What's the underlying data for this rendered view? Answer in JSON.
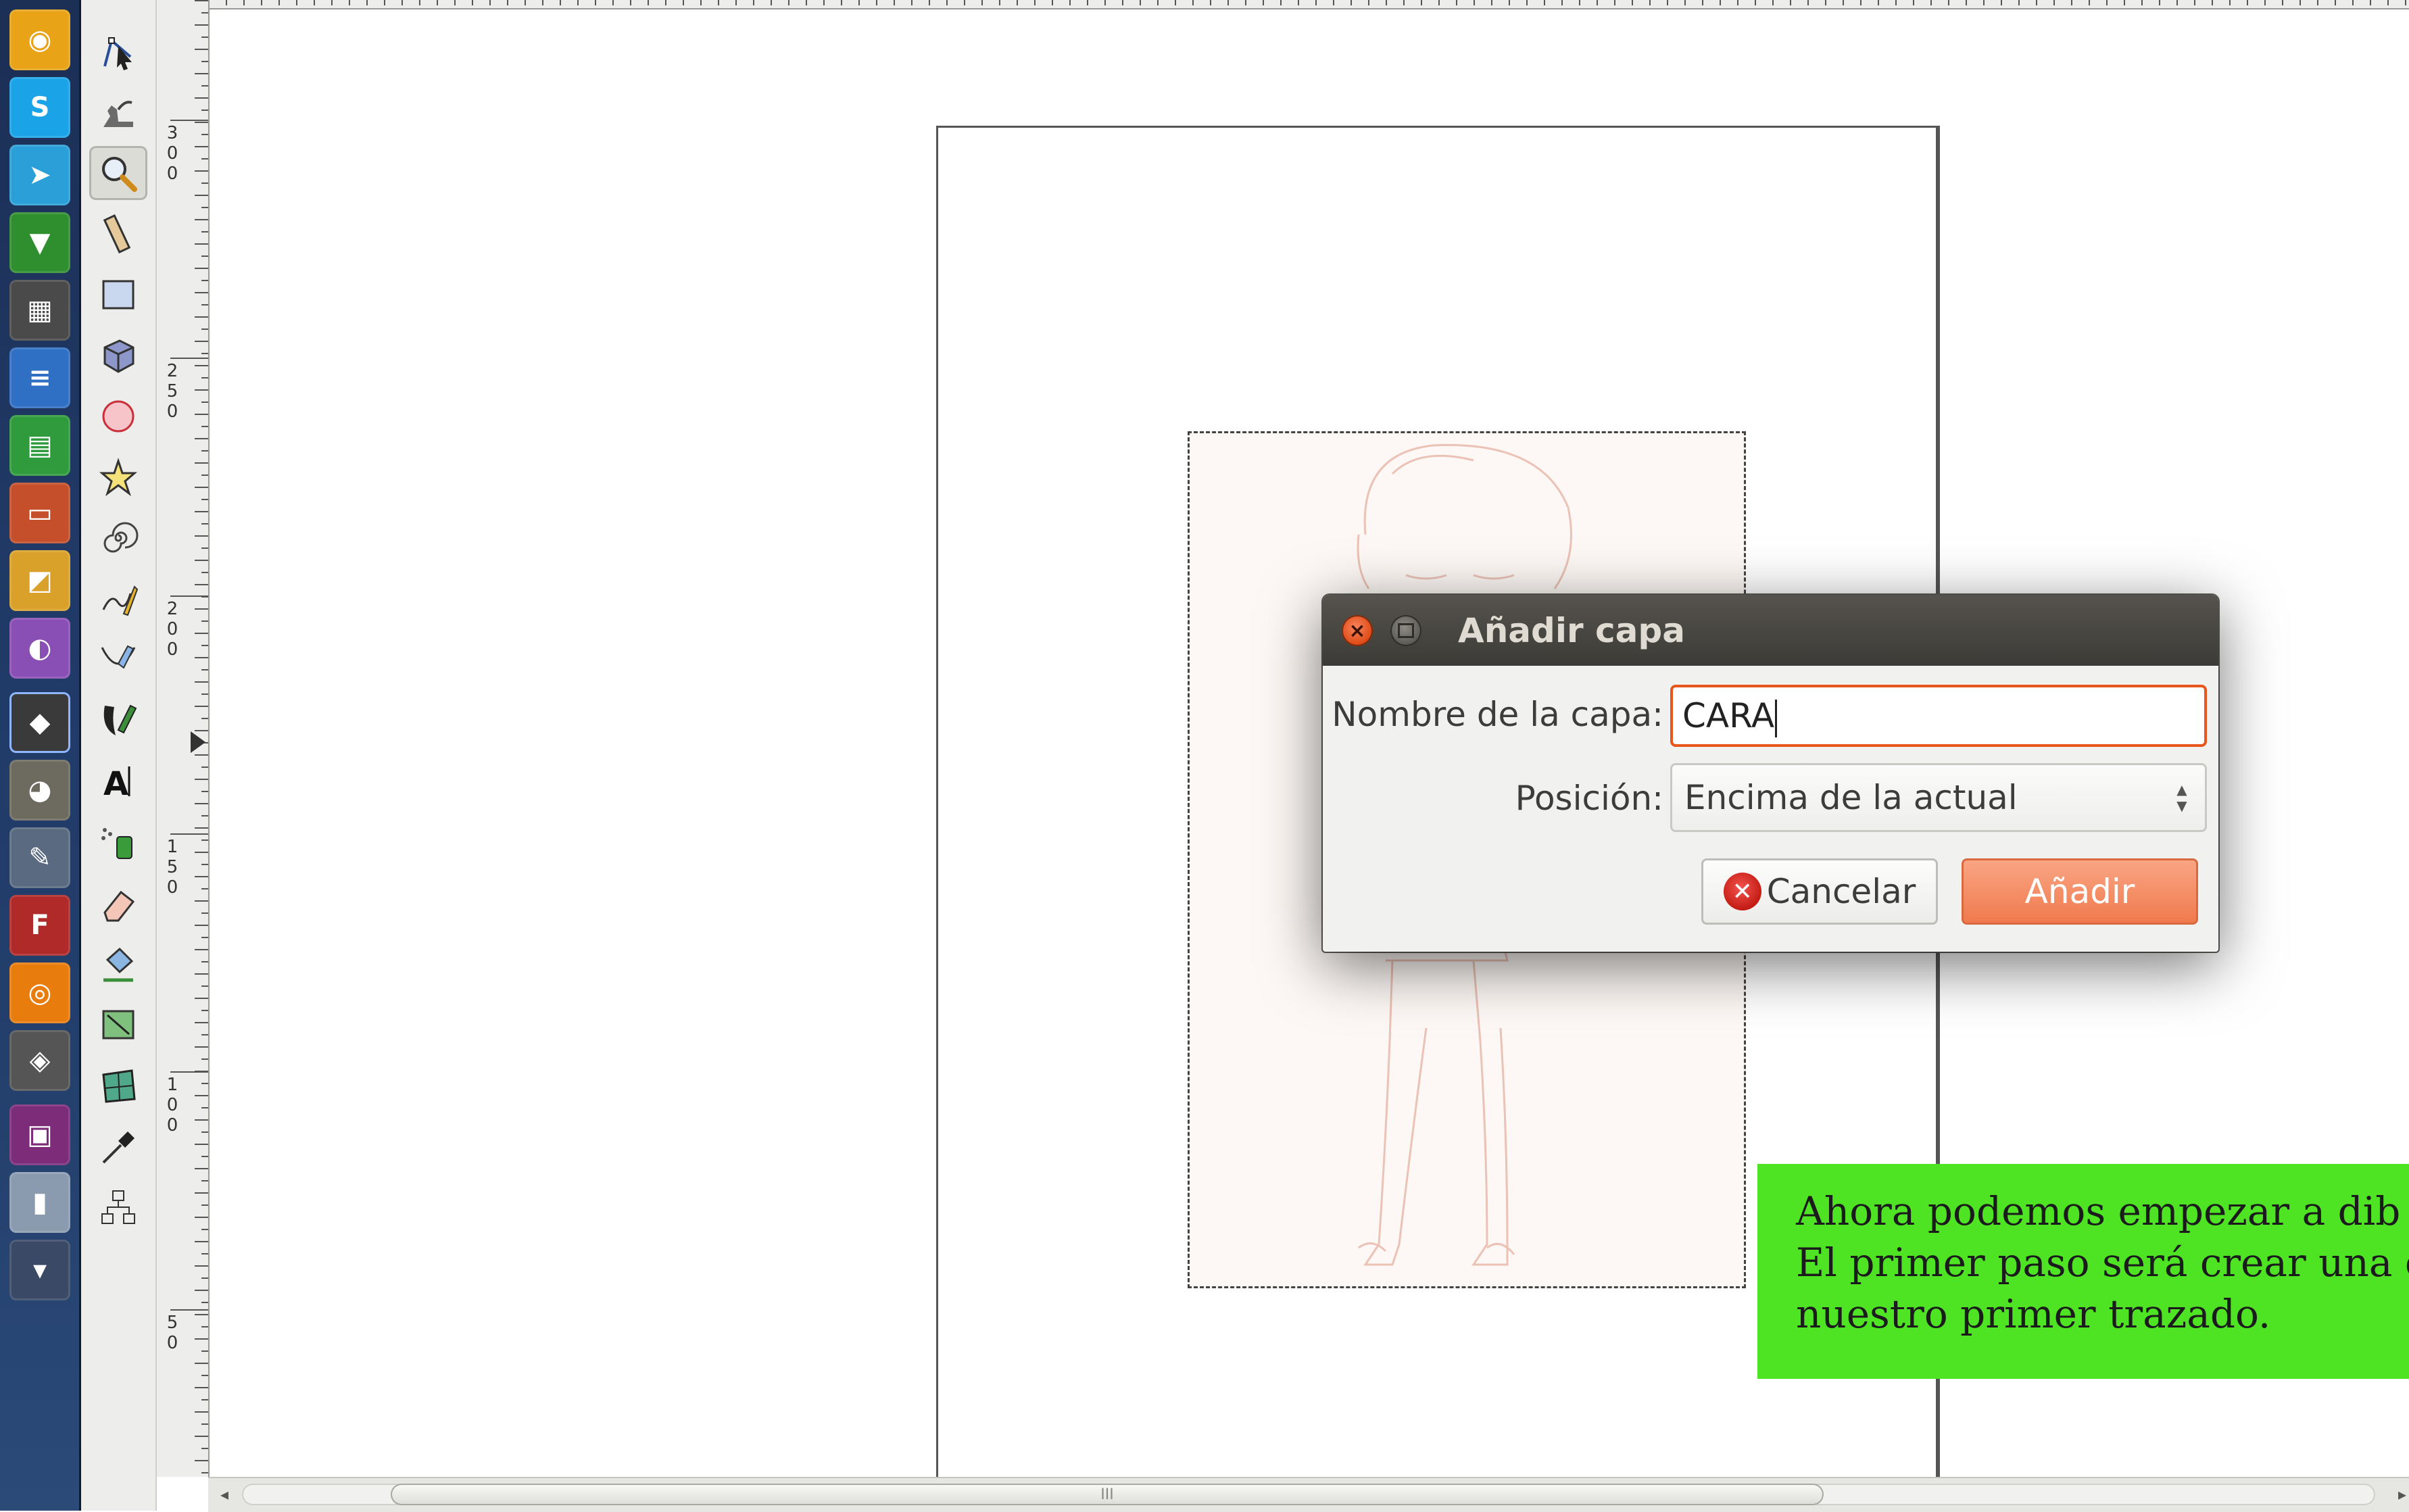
{
  "launcher": {
    "apps": [
      {
        "name": "chrome",
        "color": "#e8a317",
        "glyph": "◉"
      },
      {
        "name": "skype",
        "color": "#1aa3e6",
        "glyph": "S"
      },
      {
        "name": "telegram",
        "color": "#2b9fd8",
        "glyph": "➤"
      },
      {
        "name": "green-app",
        "color": "#2f8f2f",
        "glyph": "▼"
      },
      {
        "name": "calculator",
        "color": "#4a4a4a",
        "glyph": "▦"
      },
      {
        "name": "writer",
        "color": "#2f6fc4",
        "glyph": "≡"
      },
      {
        "name": "calc",
        "color": "#2f9b3c",
        "glyph": "▤"
      },
      {
        "name": "impress",
        "color": "#c44f2a",
        "glyph": "▭"
      },
      {
        "name": "draw",
        "color": "#d9a12a",
        "glyph": "◩"
      },
      {
        "name": "color-app",
        "color": "#8a4fb5",
        "glyph": "◐"
      },
      {
        "name": "inkscape",
        "color": "#3a3a3a",
        "glyph": "◆"
      },
      {
        "name": "gimp",
        "color": "#6d6a5f",
        "glyph": "◕"
      },
      {
        "name": "editor",
        "color": "#5a6a80",
        "glyph": "✎"
      },
      {
        "name": "fontforge",
        "color": "#b02a2a",
        "glyph": "F"
      },
      {
        "name": "blender",
        "color": "#e87d0d",
        "glyph": "◎"
      },
      {
        "name": "box-app",
        "color": "#555555",
        "glyph": "◈"
      },
      {
        "name": "window-app",
        "color": "#7d2c7a",
        "glyph": "▣"
      },
      {
        "name": "storage",
        "color": "#8a9bb0",
        "glyph": "▮"
      },
      {
        "name": "trash",
        "color": "#3a4a66",
        "glyph": "▾"
      }
    ]
  },
  "ruler": {
    "labels": [
      "300",
      "250",
      "200",
      "150",
      "100",
      "50"
    ]
  },
  "dialog": {
    "title": "Añadir capa",
    "name_label": "Nombre de la capa:",
    "name_value": "CARA",
    "position_label": "Posición:",
    "position_value": "Encima de la actual",
    "cancel_label": "Cancelar",
    "add_label": "Añadir"
  },
  "note": {
    "line1": "Ahora podemos empezar a dib",
    "line2": "El primer paso será crear una c",
    "line3": "nuestro primer trazado."
  },
  "scrollbar": {
    "grip": "III",
    "left_arrow": "◂",
    "right_arrow": "▸"
  },
  "colors": {
    "accent": "#e9561c",
    "note": "#4ee424",
    "add_button": "#f07a4d"
  }
}
